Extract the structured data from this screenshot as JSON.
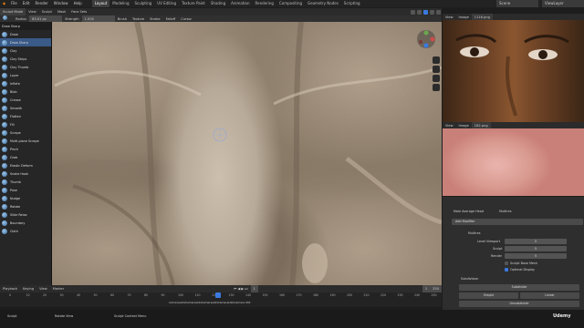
{
  "menus": [
    "File",
    "Edit",
    "Render",
    "Window",
    "Help"
  ],
  "workspaces": [
    "Layout",
    "Modeling",
    "Sculpting",
    "UV Editing",
    "Texture Paint",
    "Shading",
    "Animation",
    "Rendering",
    "Compositing",
    "Geometry Nodes",
    "Scripting"
  ],
  "active_workspace": "Layout",
  "scene": {
    "name": "Scene",
    "view_layer": "ViewLayer"
  },
  "viewport_header": {
    "mode": "Sculpt Mode",
    "items": [
      "View",
      "Sculpt",
      "Mask",
      "Face Sets"
    ]
  },
  "tool_header": {
    "radius_label": "Radius",
    "radius_value": "83.01 px",
    "strength_label": "Strength",
    "strength_value": "1.000",
    "items": [
      "Brush",
      "Texture",
      "Stroke",
      "Falloff",
      "Cursor"
    ]
  },
  "brush_panel_title": "Draw Sharp",
  "brushes": [
    "Draw",
    "Draw Sharp",
    "Clay",
    "Clay Strips",
    "Clay Thumb",
    "Layer",
    "Inflate",
    "Blob",
    "Crease",
    "Smooth",
    "Flatten",
    "Fill",
    "Scrape",
    "Multi-plane Scrape",
    "Pinch",
    "Grab",
    "Elastic Deform",
    "Snake Hook",
    "Thumb",
    "Pose",
    "Nudge",
    "Rotate",
    "Slide Relax",
    "Boundary",
    "Cloth"
  ],
  "active_brush": "Draw Sharp",
  "timeline": {
    "menus": [
      "Playback",
      "Keying",
      "View",
      "Marker"
    ],
    "ticks": [
      "0",
      "10",
      "20",
      "30",
      "40",
      "50",
      "60",
      "70",
      "80",
      "90",
      "100",
      "110",
      "120",
      "130",
      "140",
      "150",
      "160",
      "170",
      "180",
      "190",
      "200",
      "210",
      "220",
      "230",
      "240",
      "250"
    ],
    "current_frame": "1",
    "start": "1",
    "end": "250"
  },
  "markers": [
    "Camera(All)",
    "Camera(All)",
    "Camera(All)",
    "Camera(All)",
    "Camera 001"
  ],
  "status_bar": [
    "Sculpt",
    "Rotate View",
    "Sculpt Context Menu"
  ],
  "image_editors": [
    {
      "menus": [
        "View",
        "Image"
      ],
      "name": "1116.png"
    },
    {
      "menus": [
        "View",
        "Image"
      ],
      "name": "182.png"
    }
  ],
  "properties": {
    "object": "Male Average Head",
    "modifier_name": "Multires",
    "add_modifier": "Add Modifier",
    "level_viewport_label": "Level Viewport",
    "level_viewport_value": "5",
    "sculpt_label": "Sculpt",
    "sculpt_value": "5",
    "render_label": "Render",
    "render_value": "5",
    "sculpt_base_mesh": "Sculpt Base Mesh",
    "optimal_display": "Optimal Display",
    "subdivision_section": "Subdivision",
    "subdivide": "Subdivide",
    "simple": "Simple",
    "linear": "Linear",
    "unsubdivide": "Unsubdivide"
  },
  "watermark": "Udemy",
  "colors": {
    "accent": "#3b7ae0",
    "active_brush_bg": "#3a5a88"
  }
}
